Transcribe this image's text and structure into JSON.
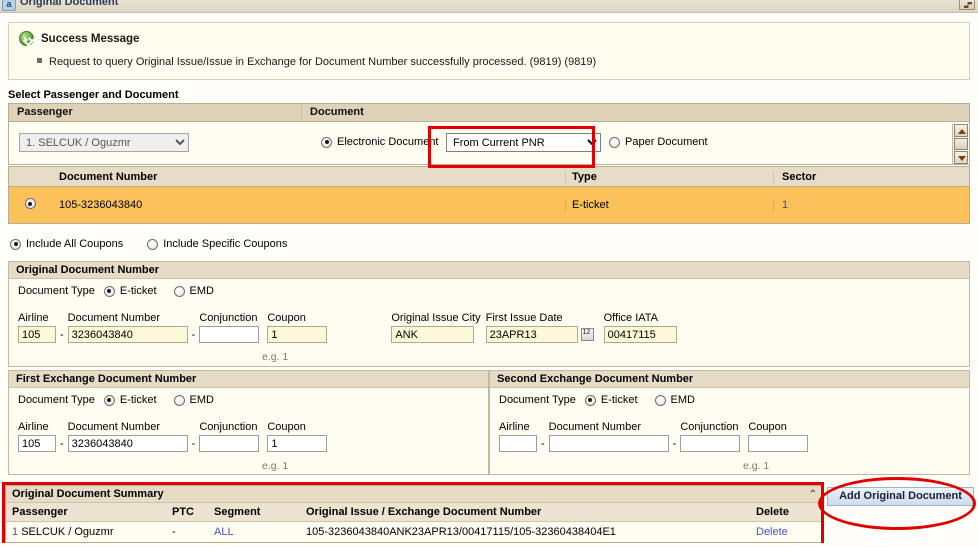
{
  "window": {
    "title": "Original Document",
    "icon": "app-icon",
    "close_label": "restore-window-icon"
  },
  "message": {
    "icon": "success-check-icon",
    "title": "Success Message",
    "items": [
      "Request to query Original Issue/Issue in Exchange for Document Number successfully processed. (9819) (9819)"
    ]
  },
  "select_section": {
    "label": "Select Passenger and Document",
    "columns": {
      "passenger": "Passenger",
      "document": "Document"
    },
    "passenger_select": {
      "value": "1. SELCUK / Oguzmr",
      "options": [
        "1. SELCUK / Oguzmr"
      ]
    },
    "electronic_document": {
      "label": "Electronic Document",
      "selected": true
    },
    "paper_document": {
      "label": "Paper Document",
      "selected": false
    },
    "source_select": {
      "value": "From Current PNR",
      "options": [
        "From Current PNR"
      ]
    }
  },
  "document_table": {
    "headers": [
      "",
      "Document Number",
      "Type",
      "Sector"
    ],
    "rows": [
      {
        "selected": true,
        "document_number": "105-3236043840",
        "type": "E-ticket",
        "sector": "1"
      }
    ]
  },
  "coupon_options": {
    "include_all": {
      "label": "Include All Coupons",
      "selected": true
    },
    "include_specific": {
      "label": "Include Specific Coupons",
      "selected": false
    }
  },
  "original_document": {
    "title": "Original Document Number",
    "doc_type_label": "Document Type",
    "eticket": {
      "label": "E-ticket",
      "selected": true
    },
    "emd": {
      "label": "EMD",
      "selected": false
    },
    "fields": {
      "airline_label": "Airline",
      "airline_value": "105",
      "document_number_label": "Document Number",
      "document_number_value": "3236043840",
      "conjunction_label": "Conjunction",
      "conjunction_value": "",
      "coupon_label": "Coupon",
      "coupon_value": "1",
      "coupon_hint": "e.g. 1",
      "issue_city_label": "Original Issue City",
      "issue_city_value": "ANK",
      "first_issue_date_label": "First Issue Date",
      "first_issue_date_value": "23APR13",
      "office_iata_label": "Office IATA",
      "office_iata_value": "00417115",
      "calendar_icon": "calendar-icon"
    }
  },
  "first_exchange": {
    "title": "First Exchange Document Number",
    "doc_type_label": "Document Type",
    "eticket": {
      "label": "E-ticket",
      "selected": true
    },
    "emd": {
      "label": "EMD",
      "selected": false
    },
    "fields": {
      "airline_label": "Airline",
      "airline_value": "105",
      "document_number_label": "Document Number",
      "document_number_value": "3236043840",
      "conjunction_label": "Conjunction",
      "conjunction_value": "",
      "coupon_label": "Coupon",
      "coupon_value": "1",
      "coupon_hint": "e.g. 1"
    }
  },
  "second_exchange": {
    "title": "Second Exchange Document Number",
    "doc_type_label": "Document Type",
    "eticket": {
      "label": "E-ticket",
      "selected": true
    },
    "emd": {
      "label": "EMD",
      "selected": false
    },
    "fields": {
      "airline_label": "Airline",
      "airline_value": "",
      "document_number_label": "Document Number",
      "document_number_value": "",
      "conjunction_label": "Conjunction",
      "conjunction_value": "",
      "coupon_label": "Coupon",
      "coupon_value": "",
      "coupon_hint": "e.g. 1"
    }
  },
  "summary": {
    "title": "Original Document Summary",
    "collapse_icon": "collapse-chevron-icon",
    "headers": [
      "Passenger",
      "PTC",
      "Segment",
      "Original Issue / Exchange Document Number",
      "Delete"
    ],
    "rows": [
      {
        "passenger_index": "1",
        "passenger": "SELCUK / Oguzmr",
        "ptc": "-",
        "segment": "ALL",
        "document": "105-3236043840ANK23APR13/00417115/105-32360438404E1",
        "delete": "Delete"
      }
    ]
  },
  "actions": {
    "add_original_document": "Add Original Document"
  },
  "colors": {
    "accent_orange": "#fbc25c",
    "annotation_red": "#e00000",
    "panel_bg": "#fffdf2",
    "header_bg": "#e6dbc4",
    "link": "#4a53c4",
    "input_bg": "#fdf8d6"
  }
}
